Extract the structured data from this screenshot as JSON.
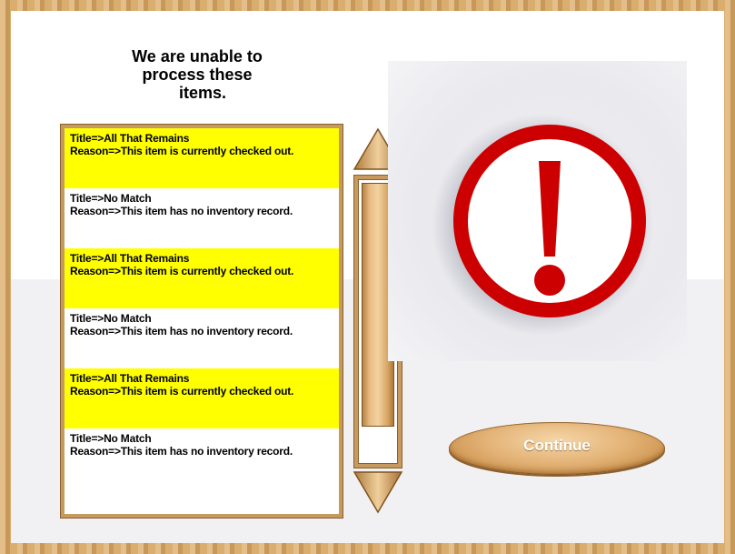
{
  "heading": {
    "line1": "We are unable to",
    "line2": "process these",
    "line3": "items."
  },
  "items": [
    {
      "title": "Title=>All That Remains",
      "reason": "Reason=>This item is currently checked out.",
      "highlight": "#ffff00"
    },
    {
      "title": "Title=>No Match",
      "reason": "Reason=>This item has no inventory record.",
      "highlight": "#ffffff"
    },
    {
      "title": "Title=>All That Remains",
      "reason": "Reason=>This item is currently checked out.",
      "highlight": "#ffff00"
    },
    {
      "title": "Title=>No Match",
      "reason": "Reason=>This item has no inventory record.",
      "highlight": "#ffffff"
    },
    {
      "title": "Title=>All That Remains",
      "reason": "Reason=>This item is currently checked out.",
      "highlight": "#ffff00"
    },
    {
      "title": "Title=>No Match",
      "reason": "Reason=>This item has no inventory record.",
      "highlight": "#ffffff"
    }
  ],
  "scrollbar": {
    "up_icon": "triangle-up-icon",
    "down_icon": "triangle-down-icon"
  },
  "alert": {
    "icon": "exclamation-warning-icon",
    "color": "#cc0000"
  },
  "continue_button": {
    "label": "Continue"
  },
  "colors": {
    "frame_wood": "#d4a668",
    "highlight_yellow": "#ffff00"
  }
}
